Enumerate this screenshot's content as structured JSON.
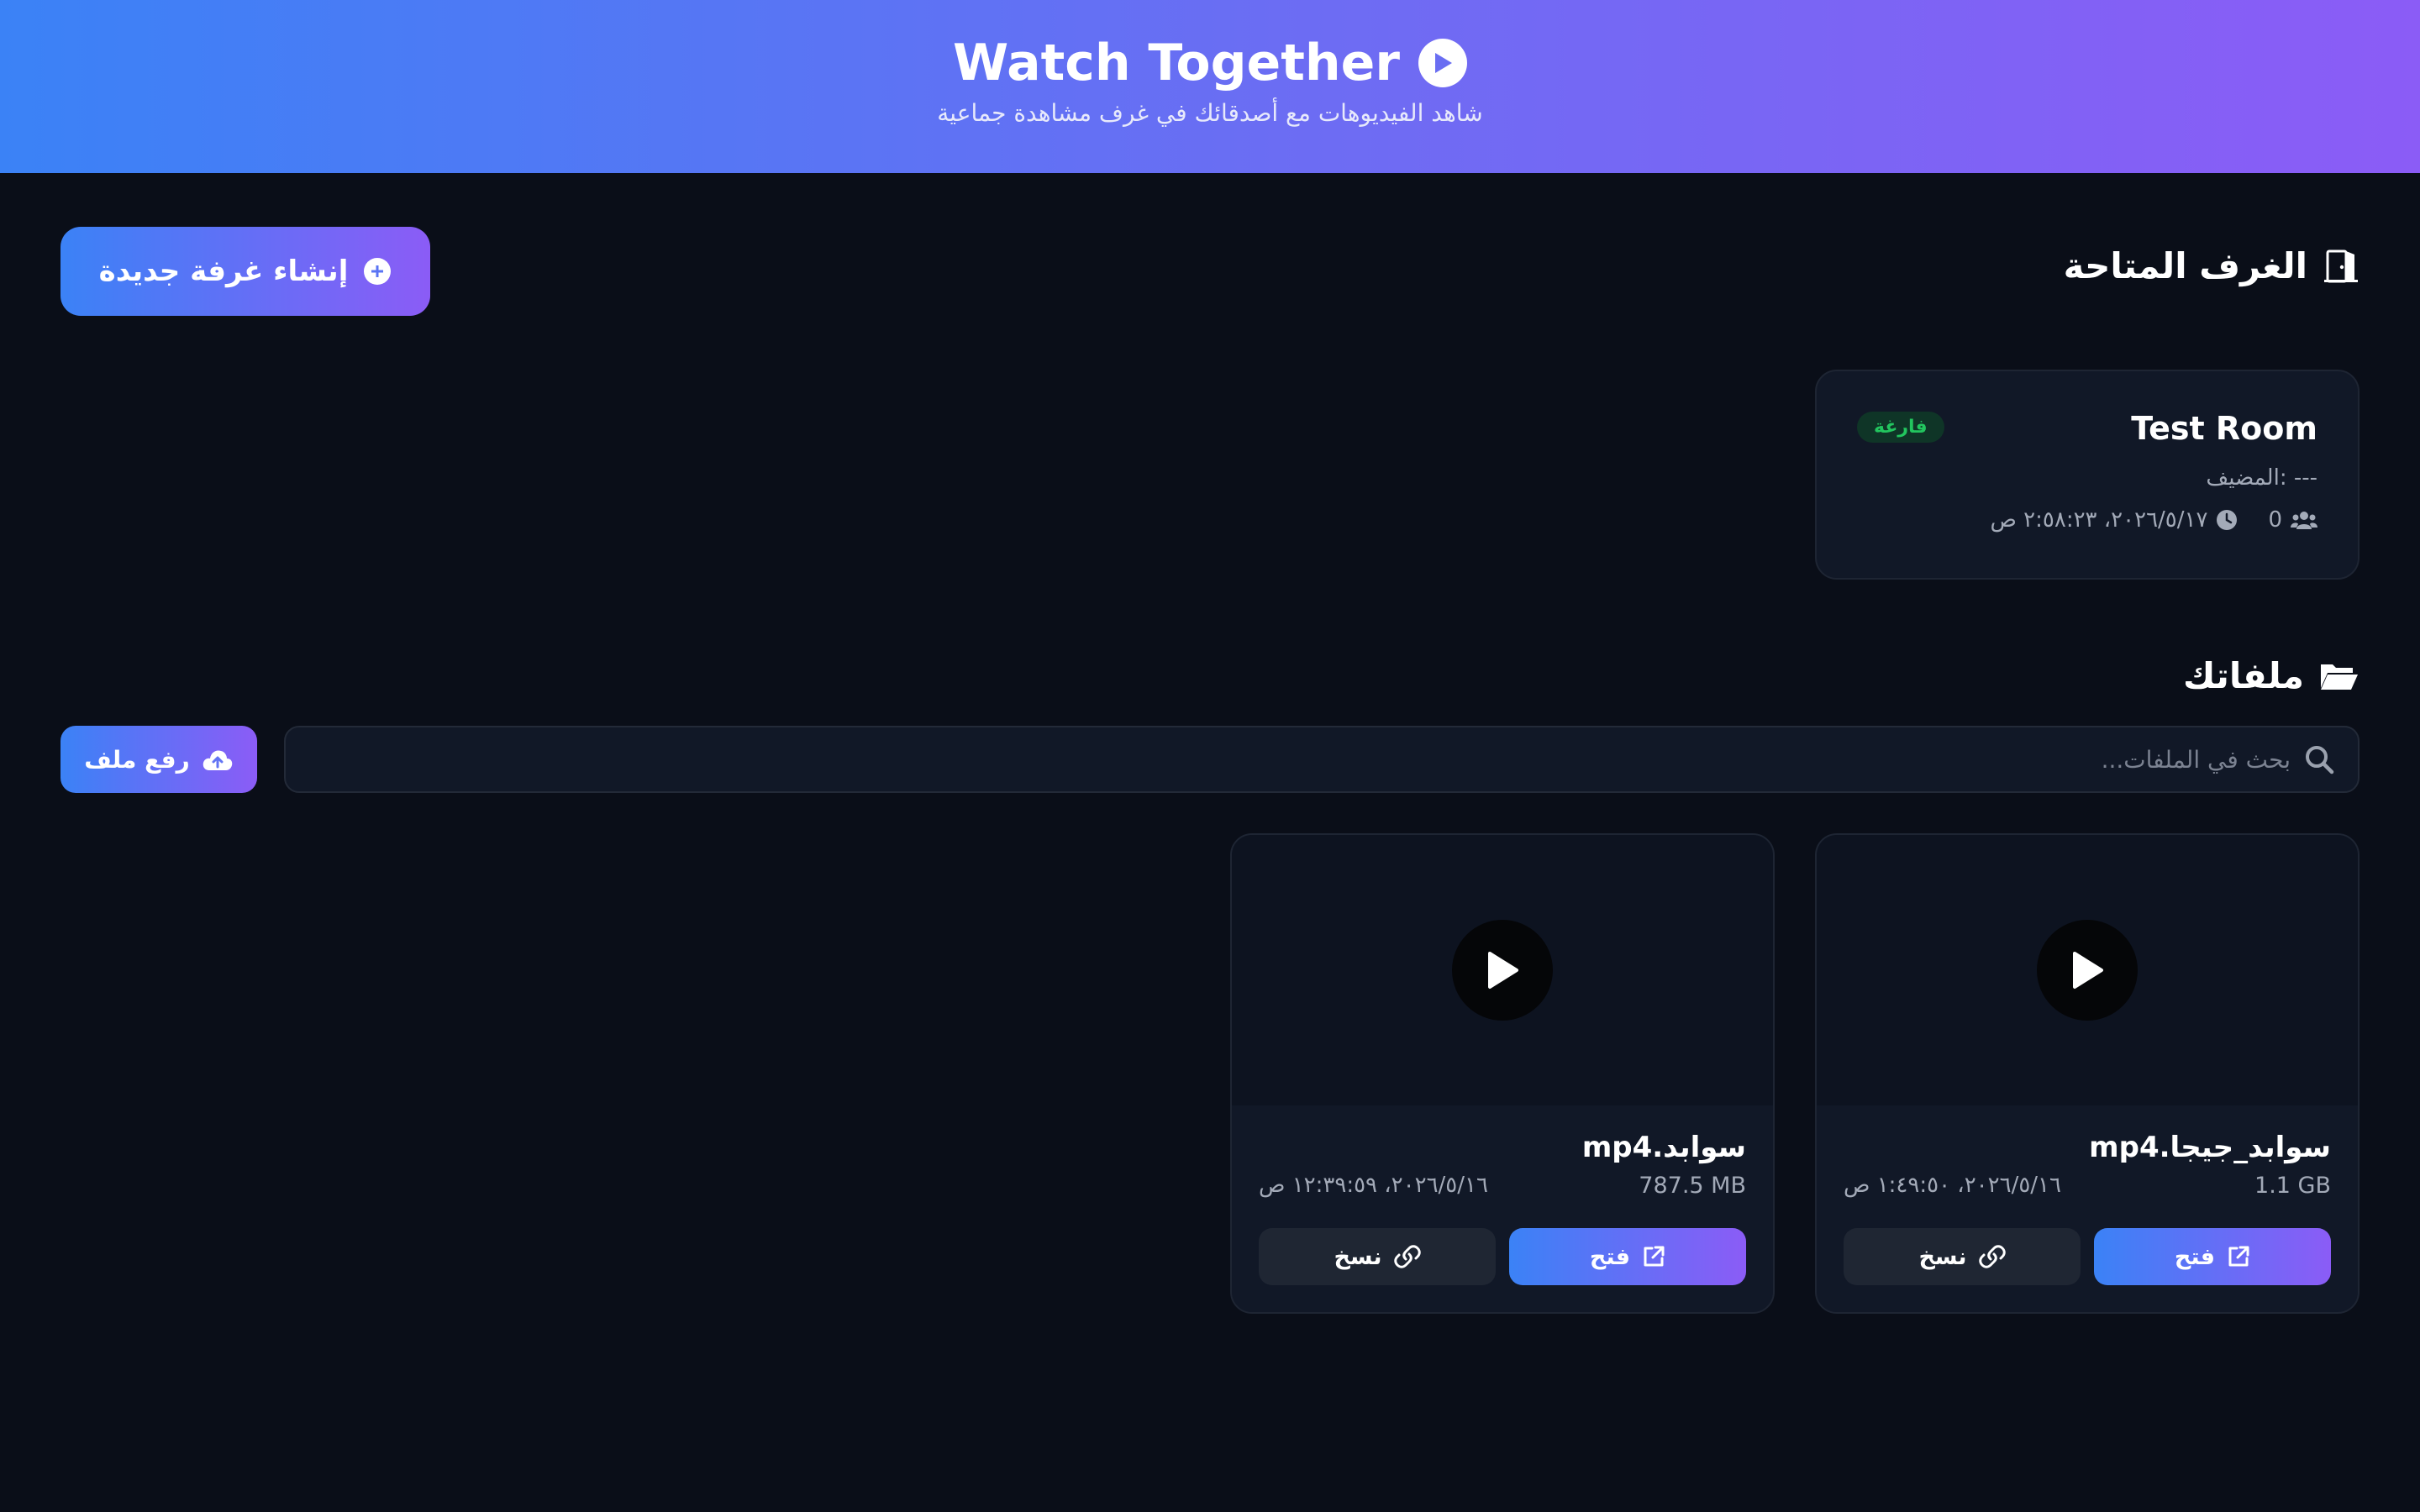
{
  "header": {
    "title": "Watch Together",
    "subtitle": "شاهد الفيديوهات مع أصدقائك في غرف مشاهدة جماعية"
  },
  "rooms_section": {
    "title": "الغرف المتاحة",
    "create_button_label": "إنشاء غرفة جديدة",
    "rooms": [
      {
        "name": "Test Room",
        "status": "فارغة",
        "host_label": "المضيف: ---",
        "participants": "0",
        "created": "٢٠٢٦/٥/١٧، ٢:٥٨:٢٣ ص"
      }
    ]
  },
  "files_section": {
    "title": "ملفاتك",
    "upload_button_label": "رفع ملف",
    "search_placeholder": "بحث في الملفات...",
    "files": [
      {
        "name": "سوابد_جيجا.mp4",
        "size": "1.1 GB",
        "date": "٢٠٢٦/٥/١٦، ١:٤٩:٥٠ ص",
        "open_label": "فتح",
        "copy_label": "نسخ"
      },
      {
        "name": "سوابد.mp4",
        "size": "787.5 MB",
        "date": "٢٠٢٦/٥/١٦، ١٢:٣٩:٥٩ ص",
        "open_label": "فتح",
        "copy_label": "نسخ"
      }
    ]
  },
  "icons": {
    "title_icon": "play-circle-icon",
    "create_icon": "plus-circle-icon",
    "rooms_icon": "door-open-icon",
    "participants_icon": "users-icon",
    "time_icon": "clock-icon",
    "files_icon": "folder-open-icon",
    "upload_icon": "cloud-upload-icon",
    "search_icon": "search-icon",
    "thumb_icon": "play-icon",
    "open_icon": "external-link-icon",
    "copy_icon": "link-icon"
  },
  "colors": {
    "background": "#0a0e18",
    "card": "#111827",
    "accent_start": "#3b82f6",
    "accent_end": "#8b5cf6",
    "status_empty": "#22c55e",
    "secondary_button": "#1f2633"
  }
}
